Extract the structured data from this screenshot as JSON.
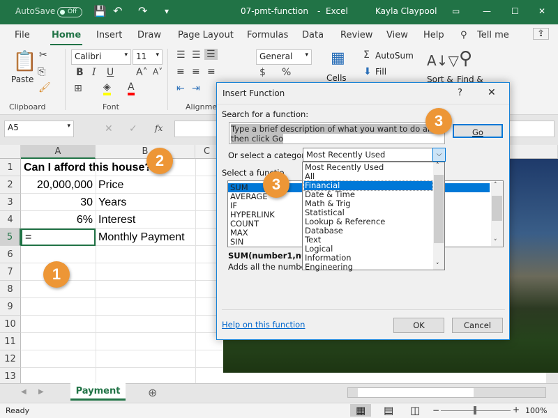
{
  "titlebar": {
    "autosave": "AutoSave",
    "autosave_state": "Off",
    "filename": "07-pmt-function",
    "app": "Excel",
    "user": "Kayla Claypool"
  },
  "tabs": [
    "File",
    "Home",
    "Insert",
    "Draw",
    "Page Layout",
    "Formulas",
    "Data",
    "Review",
    "View",
    "Help",
    "Tell me"
  ],
  "active_tab": "Home",
  "ribbon": {
    "paste": "Paste",
    "clipboard": "Clipboard",
    "font_name": "Calibri",
    "font_size": "11",
    "font": "Font",
    "alignment": "Alignment",
    "number_format": "General",
    "cells": "Cells",
    "autosum": "AutoSum",
    "fill": "Fill",
    "sort": "Sort &",
    "find": "Find &",
    "font_color": "#ff0000",
    "highlight_color": "#ffff00"
  },
  "formula_bar": {
    "name_box": "A5",
    "fx": "fx"
  },
  "columns": [
    "A",
    "B",
    "C"
  ],
  "rows": [
    "1",
    "2",
    "3",
    "4",
    "5",
    "6",
    "7",
    "8",
    "9",
    "10",
    "11",
    "12",
    "13"
  ],
  "cells": {
    "A1": "Can I afford this house?",
    "A2": "20,000,000",
    "B2": "Price",
    "A3": "30",
    "B3": "Years",
    "A4": "6%",
    "B4": "Interest",
    "A5": "=",
    "B5": "Monthly Payment"
  },
  "callouts": [
    "1",
    "2",
    "3",
    "3"
  ],
  "dialog": {
    "title": "Insert Function",
    "help": "?",
    "close": "✕",
    "search_label": "Search for a function:",
    "search_value": "Type a brief description of what you want to do and then click Go",
    "go": "Go",
    "category_label": "Or select a category:",
    "category_value": "Most Recently Used",
    "category_options": [
      "Most Recently Used",
      "All",
      "Financial",
      "Date & Time",
      "Math & Trig",
      "Statistical",
      "Lookup & Reference",
      "Database",
      "Text",
      "Logical",
      "Information",
      "Engineering"
    ],
    "highlighted_option": "Financial",
    "function_label": "Select a functio",
    "functions": [
      "SUM",
      "AVERAGE",
      "IF",
      "HYPERLINK",
      "COUNT",
      "MAX",
      "SIN"
    ],
    "syntax": "SUM(number1,numb",
    "description": "Adds all the numbers",
    "help_link": "Help on this function",
    "ok": "OK",
    "cancel": "Cancel"
  },
  "sheet_tab": "Payment",
  "status": {
    "ready": "Ready",
    "zoom": "100%"
  }
}
